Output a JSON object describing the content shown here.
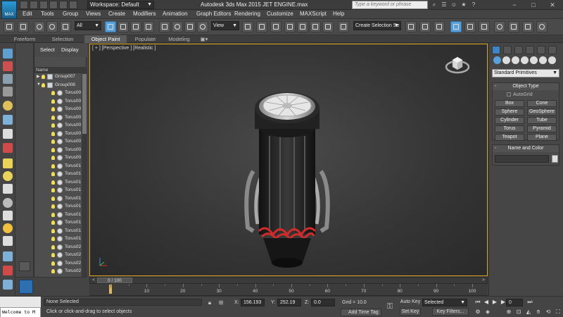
{
  "titlebar": {
    "app_logo_text": "MAX",
    "workspace": "Workspace: Default",
    "window_title": "Autodesk 3ds Max  2015    JET ENGINE.max",
    "search_placeholder": "Type a keyword or phrase",
    "minimize": "−",
    "maximize": "□",
    "close": "✕"
  },
  "menu": [
    "Edit",
    "Tools",
    "Group",
    "Views",
    "Create",
    "Modifiers",
    "Animation",
    "Graph Editors",
    "Rendering",
    "Customize",
    "MAXScript",
    "Help"
  ],
  "toolbar": {
    "selection_filter": "All",
    "reference_coord": "View",
    "named_selection": "Create Selection Se"
  },
  "ribbon_tabs": [
    {
      "label": "Freeform",
      "active": false
    },
    {
      "label": "Selection",
      "active": false
    },
    {
      "label": "Object Paint",
      "active": true
    },
    {
      "label": "Populate",
      "active": false
    },
    {
      "label": "Modeling",
      "active": false
    }
  ],
  "scene_explorer": {
    "tabs": [
      "Select",
      "Display"
    ],
    "column_header": "Name",
    "rows": [
      {
        "label": "Group007",
        "type": "group",
        "expanded": false,
        "indent": 0
      },
      {
        "label": "Group008",
        "type": "group",
        "expanded": true,
        "indent": 0
      },
      {
        "label": "Torus00",
        "type": "torus",
        "indent": 1
      },
      {
        "label": "Torus00",
        "type": "torus",
        "indent": 1
      },
      {
        "label": "Torus00",
        "type": "torus",
        "indent": 1
      },
      {
        "label": "Torus00",
        "type": "torus",
        "indent": 1
      },
      {
        "label": "Torus00",
        "type": "torus",
        "indent": 1
      },
      {
        "label": "Torus00",
        "type": "torus",
        "indent": 1
      },
      {
        "label": "Torus00",
        "type": "torus",
        "indent": 1
      },
      {
        "label": "Torus00",
        "type": "torus",
        "indent": 1
      },
      {
        "label": "Torus00",
        "type": "torus",
        "indent": 1
      },
      {
        "label": "Torus01",
        "type": "torus",
        "indent": 1
      },
      {
        "label": "Torus01",
        "type": "torus",
        "indent": 1
      },
      {
        "label": "Torus01",
        "type": "torus",
        "indent": 1
      },
      {
        "label": "Torus01",
        "type": "torus",
        "indent": 1
      },
      {
        "label": "Torus01",
        "type": "torus",
        "indent": 1
      },
      {
        "label": "Torus01",
        "type": "torus",
        "indent": 1
      },
      {
        "label": "Torus01",
        "type": "torus",
        "indent": 1
      },
      {
        "label": "Torus01",
        "type": "torus",
        "indent": 1
      },
      {
        "label": "Torus01",
        "type": "torus",
        "indent": 1
      },
      {
        "label": "Torus01",
        "type": "torus",
        "indent": 1
      },
      {
        "label": "Torus02",
        "type": "torus",
        "indent": 1
      },
      {
        "label": "Torus02",
        "type": "torus",
        "indent": 1
      },
      {
        "label": "Torus02",
        "type": "torus",
        "indent": 1
      },
      {
        "label": "Torus02",
        "type": "torus",
        "indent": 1
      }
    ]
  },
  "viewport": {
    "label": "[ + ] [Perspective ] [Realistic ]"
  },
  "timeslider": {
    "label": "0 / 100",
    "prev": "<",
    "next": ">"
  },
  "trackbar": {
    "ticks": [
      {
        "label": "0",
        "frame": 0
      },
      {
        "label": "10",
        "frame": 10
      },
      {
        "label": "20",
        "frame": 20
      },
      {
        "label": "30",
        "frame": 30
      },
      {
        "label": "40",
        "frame": 40
      },
      {
        "label": "50",
        "frame": 50
      },
      {
        "label": "60",
        "frame": 60
      },
      {
        "label": "70",
        "frame": 70
      },
      {
        "label": "80",
        "frame": 80
      },
      {
        "label": "90",
        "frame": 90
      },
      {
        "label": "100",
        "frame": 100
      }
    ],
    "min_frame": 0,
    "max_frame": 100,
    "current_frame": 0
  },
  "status": {
    "maxscript_output": "Welcome to M",
    "selection_status": "None Selected",
    "prompt": "Click or click-and-drag to select objects",
    "x_label": "X:",
    "x_value": "156.193",
    "y_label": "Y:",
    "y_value": "252.19",
    "z_label": "Z:",
    "z_value": "0.0",
    "grid": "Grid = 10.0",
    "add_time_tag": "Add Time Tag",
    "auto_key": "Auto Key",
    "key_mode": "Selected",
    "set_key": "Set Key",
    "key_filters": "Key Filters...",
    "current_frame": "0"
  },
  "command_panel": {
    "category": "Standard Primitives",
    "object_type_title": "Object Type",
    "autogrid": "AutoGrid",
    "buttons": [
      "Box",
      "Cone",
      "Sphere",
      "GeoSphere",
      "Cylinder",
      "Tube",
      "Torus",
      "Pyramid",
      "Teapot",
      "Plane"
    ],
    "name_color_title": "Name and Color",
    "collapse": "-"
  },
  "colors": {
    "viewport_border": "#d8a01c",
    "active_tool": "#5aa0d8",
    "engine_red": "#d22b2b"
  }
}
